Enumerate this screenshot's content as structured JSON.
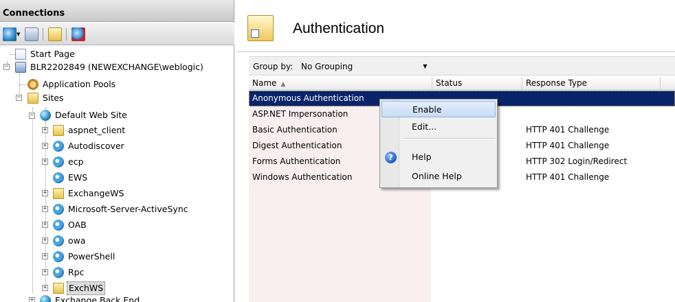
{
  "connections": {
    "title": "Connections",
    "toolbar": [
      {
        "name": "connect-icon"
      },
      {
        "name": "save-icon"
      },
      {
        "name": "up-folder-icon"
      },
      {
        "name": "disconnect-icon"
      }
    ],
    "tree": [
      {
        "label": "Start Page",
        "icon": "start-page-icon"
      },
      {
        "label": "BLR2202849 (NEWEXCHANGE\\weblogic)",
        "icon": "server-icon"
      },
      {
        "label": "Application Pools",
        "icon": "app-pool-icon"
      },
      {
        "label": "Sites",
        "icon": "folder-icon"
      },
      {
        "label": "Default Web Site",
        "icon": "globe-icon"
      },
      {
        "label": "aspnet_client",
        "icon": "folder-icon"
      },
      {
        "label": "Autodiscover",
        "icon": "application-icon"
      },
      {
        "label": "ecp",
        "icon": "application-icon"
      },
      {
        "label": "EWS",
        "icon": "application-icon"
      },
      {
        "label": "ExchangeWS",
        "icon": "virtual-directory-icon"
      },
      {
        "label": "Microsoft-Server-ActiveSync",
        "icon": "application-icon"
      },
      {
        "label": "OAB",
        "icon": "application-icon"
      },
      {
        "label": "owa",
        "icon": "application-icon"
      },
      {
        "label": "PowerShell",
        "icon": "application-icon"
      },
      {
        "label": "Rpc",
        "icon": "application-icon"
      },
      {
        "label": "ExchWS",
        "icon": "virtual-directory-icon"
      },
      {
        "label": "Exchange Back End",
        "icon": "globe-icon"
      }
    ]
  },
  "main": {
    "title": "Authentication",
    "group_by": {
      "label": "Group by:",
      "value": "No Grouping"
    },
    "columns": {
      "name": "Name",
      "status": "Status",
      "response_type": "Response Type"
    },
    "rows": [
      {
        "name": "Anonymous Authentication",
        "status": "",
        "response_type": ""
      },
      {
        "name": "ASP.NET Impersonation",
        "status": "",
        "response_type": ""
      },
      {
        "name": "Basic Authentication",
        "status": "",
        "response_type": "HTTP 401 Challenge"
      },
      {
        "name": "Digest Authentication",
        "status": "",
        "response_type": "HTTP 401 Challenge"
      },
      {
        "name": "Forms Authentication",
        "status": "",
        "response_type": "HTTP 302 Login/Redirect"
      },
      {
        "name": "Windows Authentication",
        "status": "",
        "response_type": "HTTP 401 Challenge"
      }
    ]
  },
  "context_menu": {
    "items": [
      "Enable",
      "Edit...",
      "Help",
      "Online Help"
    ]
  }
}
